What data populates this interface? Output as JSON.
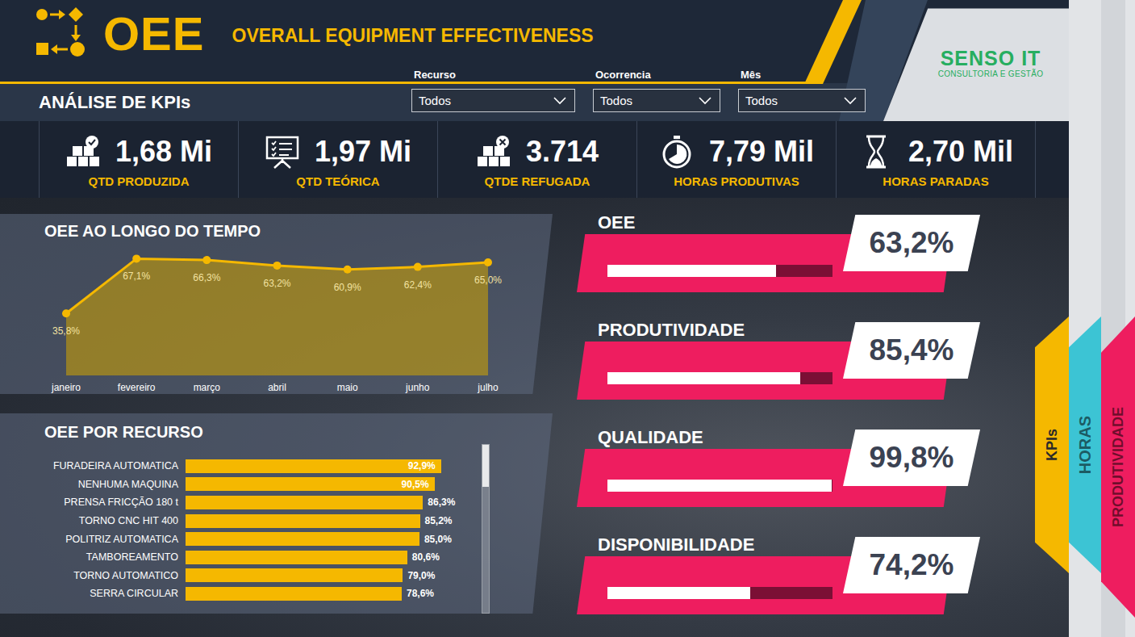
{
  "header": {
    "title": "OEE",
    "subtitle": "OVERALL EQUIPMENT EFFECTIVENESS",
    "brand": "SENSO IT",
    "tagline": "CONSULTORIA E GESTÃO"
  },
  "section": {
    "title": "ANÁLISE DE KPIs"
  },
  "filters": [
    {
      "label": "Recurso",
      "value": "Todos"
    },
    {
      "label": "Ocorrencia",
      "value": "Todos"
    },
    {
      "label": "Mês",
      "value": "Todos"
    }
  ],
  "cards": [
    {
      "value": "1,68 Mi",
      "label": "QTD PRODUZIDA"
    },
    {
      "value": "1,97 Mi",
      "label": "QTD TEÓRICA"
    },
    {
      "value": "3.714",
      "label": "QTDE REFUGADA"
    },
    {
      "value": "7,79 Mil",
      "label": "HORAS PRODUTIVAS"
    },
    {
      "value": "2,70 Mil",
      "label": "HORAS PARADAS"
    }
  ],
  "line_chart": {
    "title": "OEE AO LONGO DO TEMPO",
    "categories": [
      "janeiro",
      "fevereiro",
      "março",
      "abril",
      "maio",
      "junho",
      "julho"
    ],
    "values": [
      35.8,
      67.1,
      66.3,
      63.2,
      60.9,
      62.4,
      65.0
    ],
    "labels": [
      "35,8%",
      "67,1%",
      "66,3%",
      "63,2%",
      "60,9%",
      "62,4%",
      "65,0%"
    ]
  },
  "bar_chart": {
    "title": "OEE POR RECURSO",
    "bars": [
      {
        "name": "FURADEIRA AUTOMATICA",
        "value": 92.9,
        "label": "92,9%"
      },
      {
        "name": "NENHUMA MAQUINA",
        "value": 90.5,
        "label": "90,5%"
      },
      {
        "name": "PRENSA FRICÇÃO 180 t",
        "value": 86.3,
        "label": "86,3%"
      },
      {
        "name": "TORNO CNC HIT 400",
        "value": 85.2,
        "label": "85,2%"
      },
      {
        "name": "POLITRIZ AUTOMATICA",
        "value": 85.0,
        "label": "85,0%"
      },
      {
        "name": "TAMBOREAMENTO",
        "value": 80.6,
        "label": "80,6%"
      },
      {
        "name": "TORNO AUTOMATICO",
        "value": 79.0,
        "label": "79,0%"
      },
      {
        "name": "SERRA CIRCULAR",
        "value": 78.6,
        "label": "78,6%"
      }
    ],
    "scrollbar": {
      "level": 0.25
    }
  },
  "gauges": [
    {
      "title": "OEE",
      "reading": "63,2%",
      "level": 0.75
    },
    {
      "title": "PRODUTIVIDADE",
      "reading": "85,4%",
      "level": 0.857
    },
    {
      "title": "QUALIDADE",
      "reading": "99,8%",
      "level": 0.998
    },
    {
      "title": "DISPONIBILIDADE",
      "reading": "74,2%",
      "level": 0.635
    }
  ],
  "nav_tabs": [
    {
      "label": "KPIs",
      "selected": true,
      "color": "#f5b800"
    },
    {
      "label": "HORAS",
      "selected": false,
      "color": "#3cc4d4"
    },
    {
      "label": "PRODUTIVIDADE",
      "selected": false,
      "color": "#ee1d5f"
    }
  ]
}
